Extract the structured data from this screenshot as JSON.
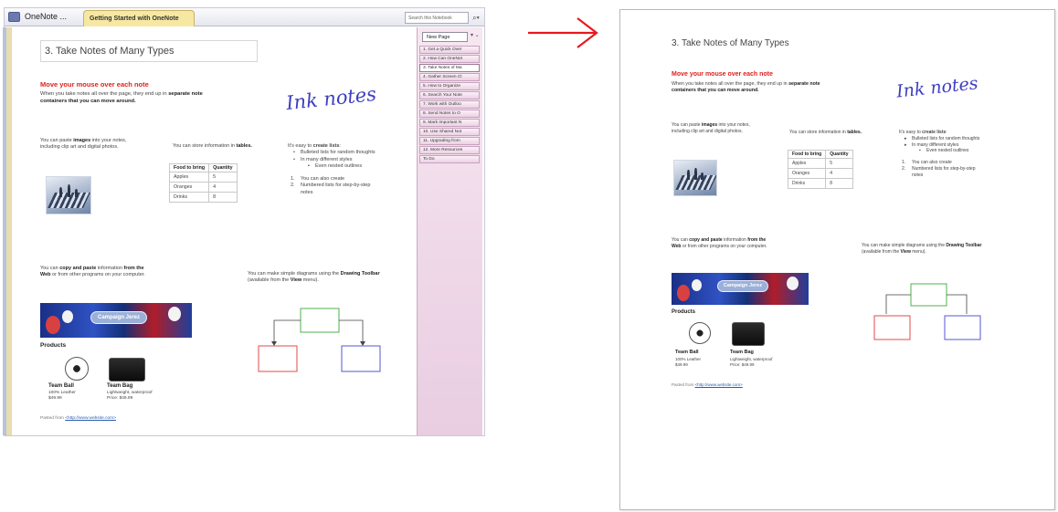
{
  "window": {
    "notebook_label": "OneNote ...",
    "section_tab": "Getting Started with OneNote",
    "search_placeholder": "Search this Notebook",
    "search_icon": "search-icon"
  },
  "page_tabs": {
    "new_page": "New Page",
    "items": [
      "1. Get a Quick Over",
      "2. How Can OneNot",
      "3. Take Notes of Ma",
      "4. Gather Screen Cl",
      "5. How to Organize",
      "6. Search Your Note",
      "7. Work with Outloo",
      "8. Send Notes to O",
      "9. Mark Important N",
      "10. Use Shared Not",
      "11. Upgrading from",
      "12. More Resources",
      "To Do"
    ],
    "active_index": 2
  },
  "note": {
    "title": "3. Take Notes of Many Types",
    "heading": "Move your mouse over each note",
    "intro_pre": "When you take notes all over the page, they end up in ",
    "intro_bold": "separate note containers that you can move around.",
    "ink": "Ink notes",
    "images_pre": "You can paste ",
    "images_bold": "images",
    "images_post": " into your notes, including clip art and digital photos.",
    "table_intro_pre": "You can store information in ",
    "table_intro_bold": "tables.",
    "table": {
      "headers": [
        "Food to bring",
        "Quantity"
      ],
      "rows": [
        [
          "Apples",
          "5"
        ],
        [
          "Oranges",
          "4"
        ],
        [
          "Drinks",
          "8"
        ]
      ]
    },
    "lists_pre": "It's easy to ",
    "lists_bold": "create lists",
    "lists_colon": ":",
    "bullets": [
      "Bulleted lists for random thoughts",
      "In many different styles"
    ],
    "nested_bullet": "Even nested outlines",
    "numbered": [
      "You can also create",
      "Numbered lists for step-by-step notes"
    ],
    "copy_pre": "You can ",
    "copy_bold": "copy and paste",
    "copy_mid": " information ",
    "copy_bold2": "from the Web",
    "copy_post": " or from other programs on your computer.",
    "banner_text": "Campaign Jerez",
    "products_label": "Products",
    "product_1": {
      "name": "Team Ball",
      "desc_1": "100% Leather",
      "desc_2": "$49.99"
    },
    "product_2": {
      "name": "Team Bag",
      "desc_1": "Lightweight, waterproof",
      "desc_2": "Price: $49.99"
    },
    "pasted_from": "Pasted from",
    "pasted_link": "<http://www.website.com>",
    "diagram_pre": "You can make simple diagrams using the ",
    "diagram_bold": "Drawing Toolbar",
    "diagram_post": " (available from the ",
    "diagram_bold2": "View",
    "diagram_end": " menu).",
    "colors": {
      "heading": "#e0201b",
      "box_top": "#4fb04f",
      "box_left": "#e24b4b",
      "box_right": "#5656d6",
      "ink": "#3e3ec2",
      "arrow": "#e8191f"
    }
  }
}
